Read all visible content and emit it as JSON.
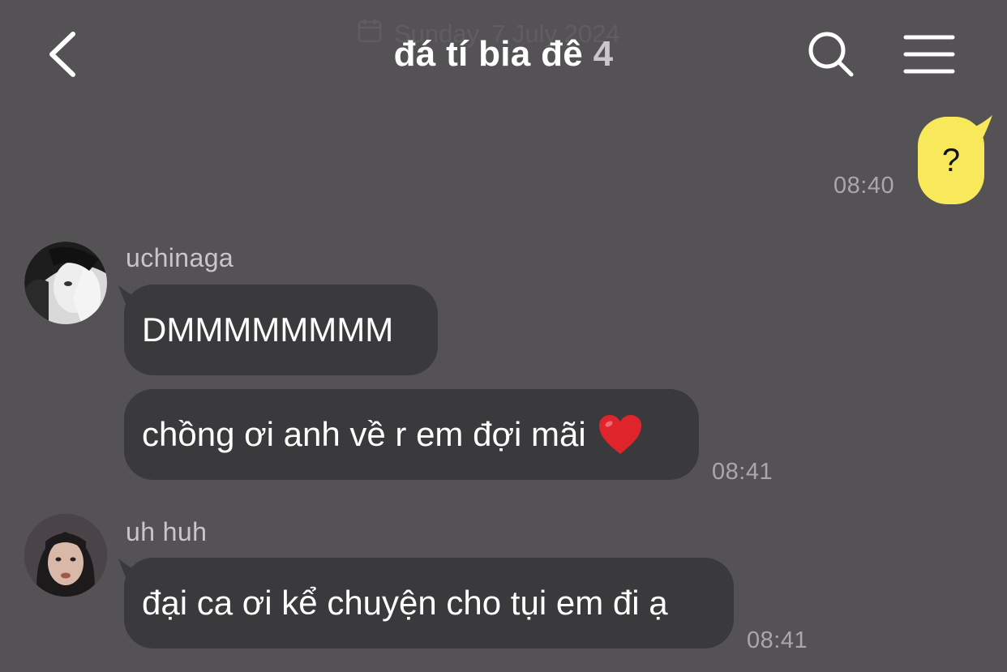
{
  "header": {
    "date": "Sunday, 7 July 2024",
    "title": "đá tí bia đê",
    "member_count": "4"
  },
  "icons": {
    "back": "chevron-left-icon",
    "search": "search-icon",
    "menu": "hamburger-menu-icon",
    "calendar": "calendar-icon"
  },
  "colors": {
    "background": "#545255",
    "own_bubble": "#f8e95a",
    "other_bubble": "#3a393b",
    "timestamp": "#a9a7aa"
  },
  "messages": {
    "own_1": {
      "text": "?",
      "time": "08:40"
    },
    "group_1": {
      "sender": "uchinaga",
      "bubble_1": "DMMMMMMMM",
      "bubble_2": "chồng ơi anh về r em đợi mãi",
      "bubble_2_emoji": "red-heart",
      "time": "08:41"
    },
    "group_2": {
      "sender": "uh huh",
      "bubble_1": "đại ca ơi kể chuyện cho tụi em đi ạ",
      "time": "08:41"
    }
  }
}
